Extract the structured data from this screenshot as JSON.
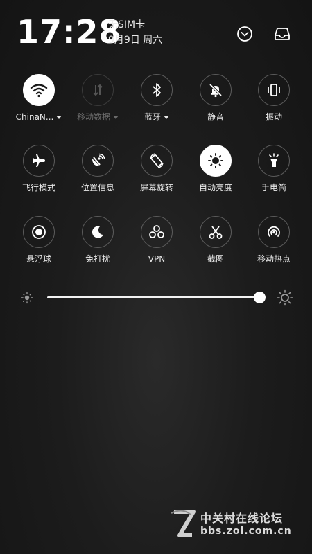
{
  "status": {
    "time": "17:28",
    "sim": "无SIM卡",
    "date": "9月9日 周六"
  },
  "top_icons": [
    "chevron-down-icon",
    "inbox-icon"
  ],
  "tiles": [
    {
      "label": "ChinaN...",
      "icon": "wifi-icon",
      "state": "active",
      "dropdown": true
    },
    {
      "label": "移动数据",
      "icon": "mobile-data-icon",
      "state": "disabled",
      "dropdown": true
    },
    {
      "label": "蓝牙",
      "icon": "bluetooth-icon",
      "state": "off",
      "dropdown": true
    },
    {
      "label": "静音",
      "icon": "mute-icon",
      "state": "off"
    },
    {
      "label": "振动",
      "icon": "vibrate-icon",
      "state": "off"
    },
    {
      "label": "飞行模式",
      "icon": "airplane-icon",
      "state": "off"
    },
    {
      "label": "位置信息",
      "icon": "location-icon",
      "state": "off"
    },
    {
      "label": "屏幕旋转",
      "icon": "rotate-icon",
      "state": "off"
    },
    {
      "label": "自动亮度",
      "icon": "auto-brightness-icon",
      "state": "active"
    },
    {
      "label": "手电筒",
      "icon": "flashlight-icon",
      "state": "off"
    },
    {
      "label": "悬浮球",
      "icon": "floating-ball-icon",
      "state": "off"
    },
    {
      "label": "免打扰",
      "icon": "do-not-disturb-icon",
      "state": "off"
    },
    {
      "label": "VPN",
      "icon": "vpn-icon",
      "state": "off"
    },
    {
      "label": "截图",
      "icon": "screenshot-icon",
      "state": "off"
    },
    {
      "label": "移动热点",
      "icon": "hotspot-icon",
      "state": "off"
    }
  ],
  "brightness": {
    "level_percent": 100
  },
  "watermark": {
    "title": "中关村在线论坛",
    "url": "bbs.zol.com.cn"
  }
}
